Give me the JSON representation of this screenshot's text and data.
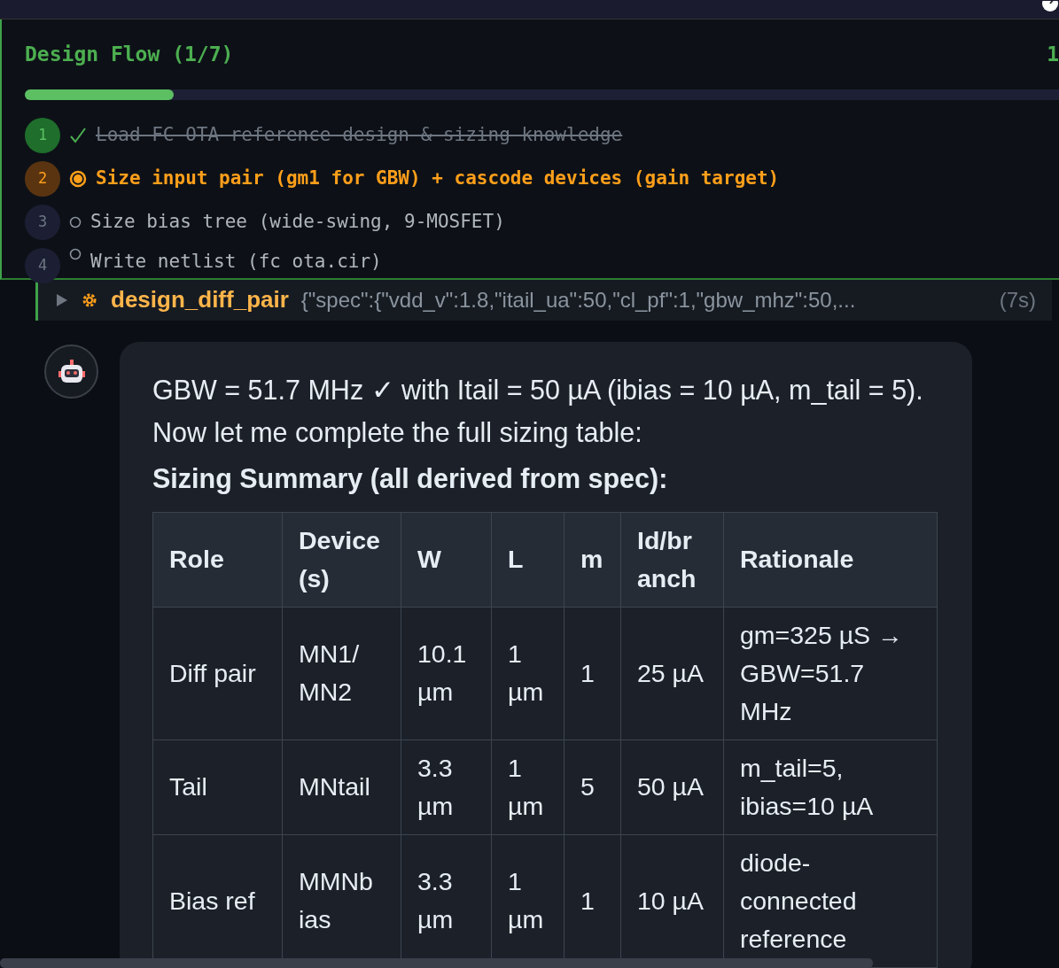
{
  "design_flow": {
    "title": "Design Flow (1/7)",
    "right_text": "1",
    "level": 0.143,
    "steps": [
      {
        "number": "1",
        "completed": true,
        "active": false,
        "text": "Load FC-OTA reference design & sizing knowledge"
      },
      {
        "number": "2",
        "completed": false,
        "active": true,
        "text": "Size input pair (gm1 for GBW) + cascode devices (gain target)"
      },
      {
        "number": "3",
        "completed": false,
        "active": false,
        "text": "Size bias tree (wide-swing, 9-MOSFET)"
      },
      {
        "number": "4",
        "completed": false,
        "active": false,
        "text": "Write netlist (fc ota.cir)"
      }
    ]
  },
  "tool_call": {
    "expanded": false,
    "name": "design_diff_pair",
    "args": "{\"spec\":{\"vdd_v\":1.8,\"itail_ua\":50,\"cl_pf\":1,\"gbw_mhz\":50,...",
    "duration": "(7s)"
  },
  "message": {
    "text": "GBW = 51.7 MHz ✓ with Itail = 50 µA (ibias = 10 µA, m_tail = 5). Now let me complete the full sizing table:",
    "heading": "Sizing Summary (all derived from spec):",
    "table": {
      "columns": [
        "Role",
        "Device (s)",
        "W",
        "L",
        "m",
        "Id/br anch",
        "Rationale"
      ],
      "rows": [
        [
          "Diff pair",
          "MN1/ MN2",
          "10.1 µm",
          "1 µm",
          "1",
          "25 µA",
          "gm=325 µS → GBW=51.7 MHz"
        ],
        [
          "Tail",
          "MNtail",
          "3.3 µm",
          "1 µm",
          "5",
          "50 µA",
          "m_tail=5, ibias=10 µA"
        ],
        [
          "Bias ref",
          "MMNb ias",
          "3.3 µm",
          "1 µm",
          "1",
          "10 µA",
          "diode-connected reference"
        ]
      ]
    }
  }
}
